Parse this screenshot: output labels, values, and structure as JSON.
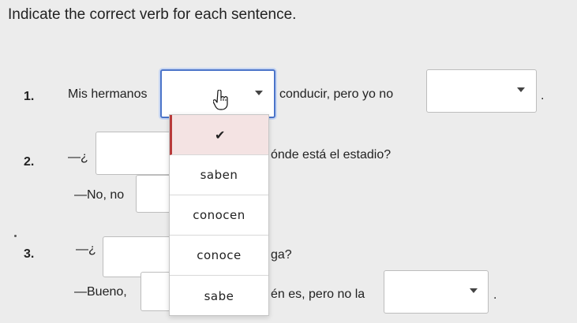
{
  "instruction": "Indicate the correct verb for each sentence.",
  "q1": {
    "number": "1.",
    "prefix": "Mis hermanos",
    "mid": "conducir, pero yo no",
    "end": "."
  },
  "q2": {
    "number": "2.",
    "line1_start": "—¿",
    "line1_end": "ónde está el estadio?",
    "line2_start": "—No, no"
  },
  "q3": {
    "number": "3.",
    "line1_start": "—¿",
    "line1_end": "ga?",
    "line2_start": "—Bueno,",
    "line2_end": "én es, pero no la",
    "end": "."
  },
  "dropdown": {
    "options": [
      "saben",
      "conocen",
      "conoce",
      "sabe"
    ]
  },
  "colors": {
    "selected_bg": "#f4e3e3",
    "selected_bar": "#b83a3a",
    "focus_border": "#4b74c9"
  },
  "icons": {
    "cursor": "hand-pointer-icon",
    "check": "checkmark-icon",
    "caret": "chevron-down-icon"
  }
}
